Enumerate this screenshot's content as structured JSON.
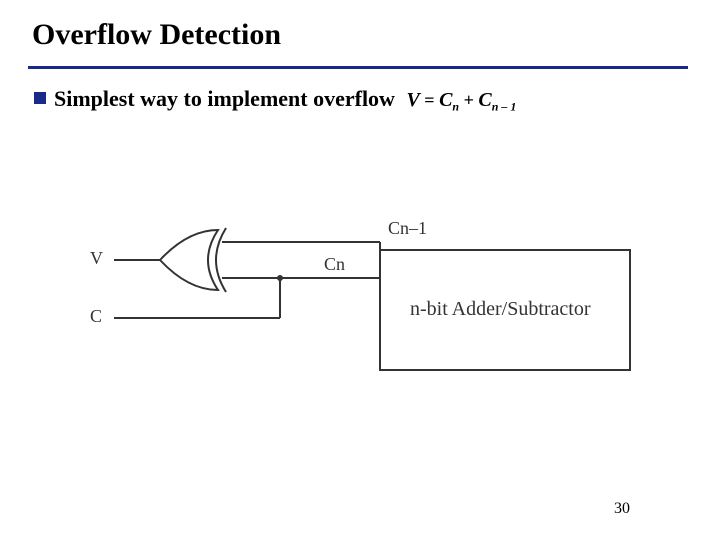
{
  "title": "Overflow Detection",
  "bullet": {
    "text": "Simplest way to implement overflow",
    "formula_V": "V",
    "formula_eq": "=",
    "formula_C1": "C",
    "formula_sub1": "n",
    "formula_plus": "+",
    "formula_C2": "C",
    "formula_sub2": "n – 1"
  },
  "diagram": {
    "label_V": "V",
    "label_C": "C",
    "label_Cn": "Cn",
    "label_Cn1": "Cn–1",
    "block": "n-bit Adder/Subtractor"
  },
  "page": "30"
}
